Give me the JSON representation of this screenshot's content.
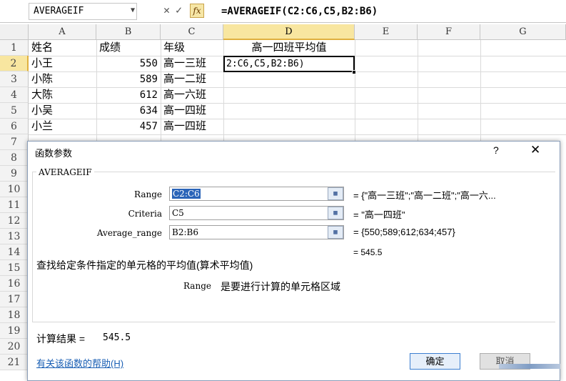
{
  "formula_bar": {
    "name_box": "AVERAGEIF",
    "cancel_symbol": "✕",
    "enter_symbol": "✓",
    "fx_label": "fx",
    "formula": "=AVERAGEIF(C2:C6,C5,B2:B6)"
  },
  "columns": [
    "A",
    "B",
    "C",
    "D",
    "E",
    "F",
    "G"
  ],
  "rows": [
    "1",
    "2",
    "3",
    "4",
    "5",
    "6",
    "7",
    "8",
    "9",
    "10",
    "11",
    "12",
    "13",
    "14",
    "15",
    "16",
    "17",
    "18",
    "19",
    "20",
    "21"
  ],
  "cells": {
    "A1": "姓名",
    "B1": "成绩",
    "C1": "年级",
    "D1": "高一四班平均值",
    "A2": "小王",
    "B2": "550",
    "C2": "高一三班",
    "D2": "2:C6,C5,B2:B6)",
    "A3": "小陈",
    "B3": "589",
    "C3": "高一二班",
    "A4": "大陈",
    "B4": "612",
    "C4": "高一六班",
    "A5": "小吴",
    "B5": "634",
    "C5": "高一四班",
    "A6": "小兰",
    "B6": "457",
    "C6": "高一四班"
  },
  "dialog": {
    "title": "函数参数",
    "help_symbol": "?",
    "close_symbol": "✕",
    "function_name": "AVERAGEIF",
    "args": [
      {
        "label": "Range",
        "value": "C2:C6",
        "result": "= {\"高一三班\";\"高一二班\";\"高一六..."
      },
      {
        "label": "Criteria",
        "value": "C5",
        "result": "= \"高一四班\""
      },
      {
        "label": "Average_range",
        "value": "B2:B6",
        "result": "= {550;589;612;634;457}"
      }
    ],
    "inline_result": "= 545.5",
    "description": "查找给定条件指定的单元格的平均值(算术平均值)",
    "arg_desc_name": "Range",
    "arg_desc_text": "是要进行计算的单元格区域",
    "calc_label": "计算结果 =",
    "calc_value": "545.5",
    "help_link": "有关该函数的帮助(H)",
    "ok_label": "确定",
    "cancel_label": "取消"
  },
  "colors": {
    "accent": "#e0b040",
    "selection": "#2a64b8",
    "link": "#1a5fb4"
  }
}
